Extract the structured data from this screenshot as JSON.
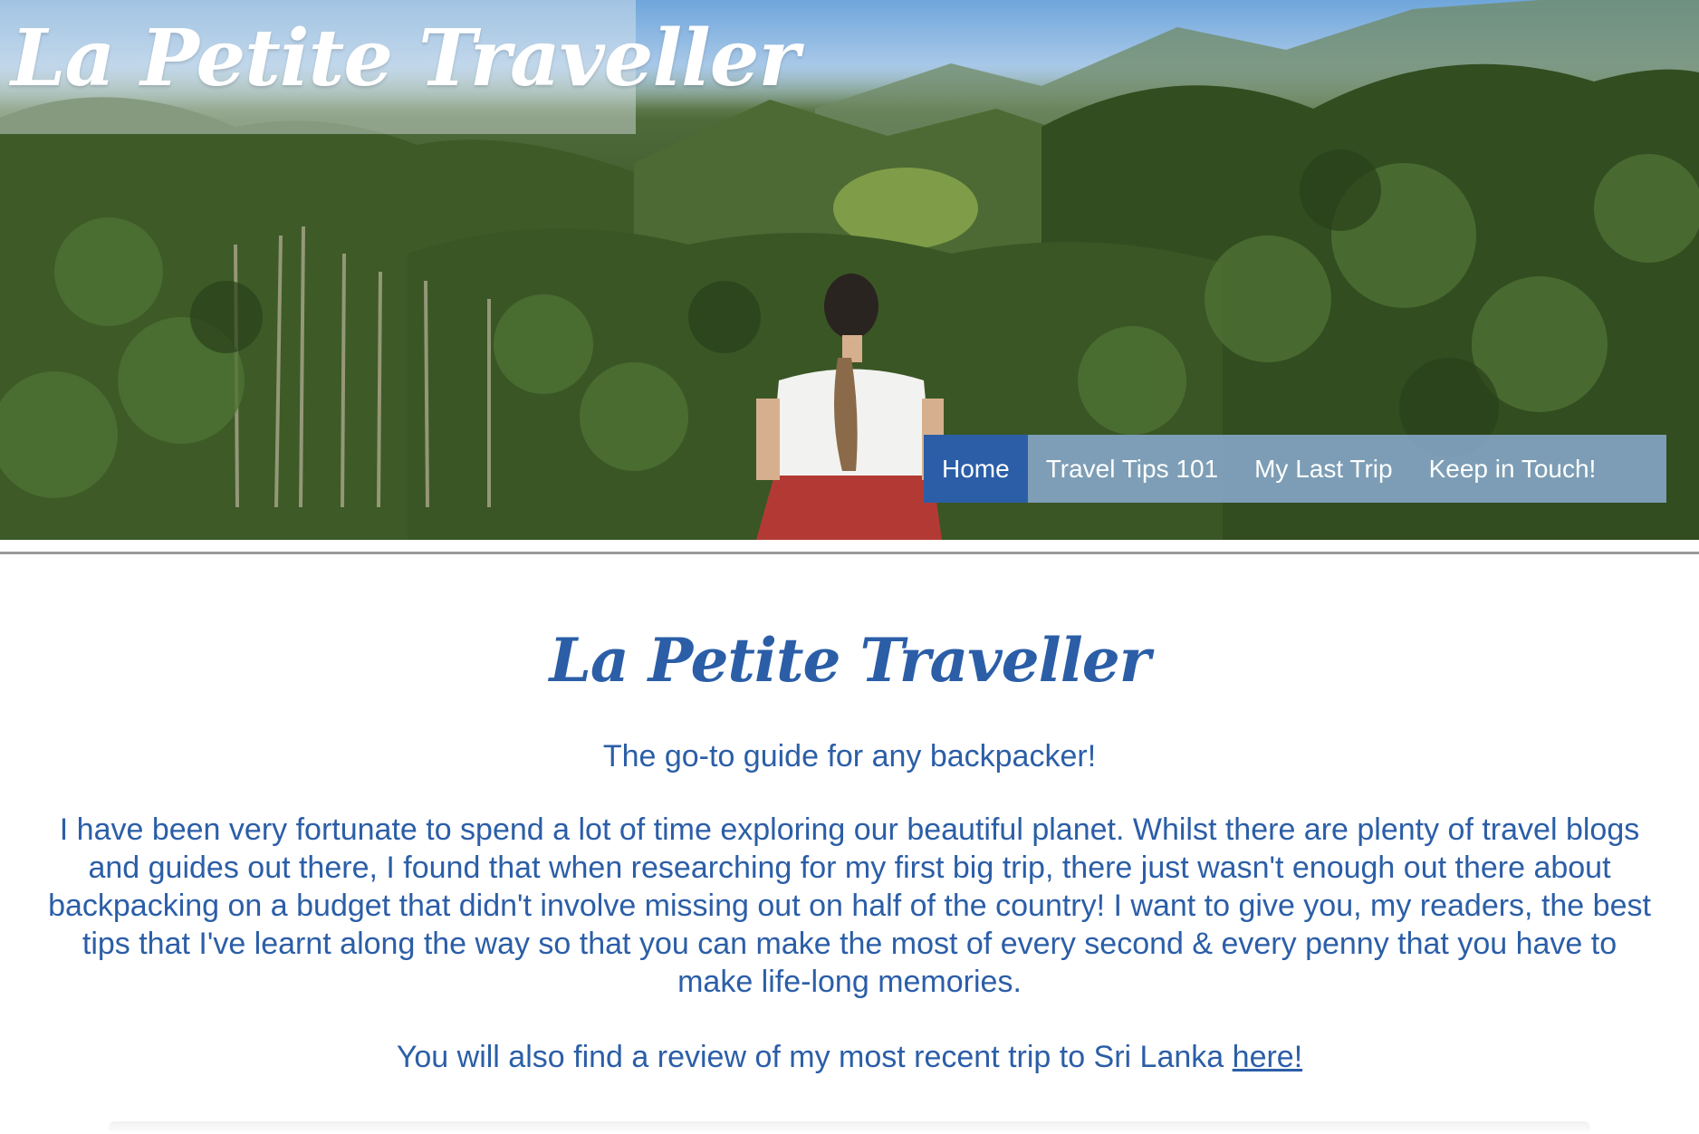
{
  "header": {
    "logo_text": "La Petite Traveller",
    "hero_image_alt": "hero-photo"
  },
  "nav": {
    "items": [
      {
        "label": "Home",
        "active": true
      },
      {
        "label": "Travel Tips 101",
        "active": false
      },
      {
        "label": "My Last Trip",
        "active": false
      },
      {
        "label": "Keep in Touch!",
        "active": false
      }
    ]
  },
  "main": {
    "title": "La Petite Traveller",
    "tagline": "The go-to guide for any backpacker!",
    "intro": "I have been very fortunate to spend a lot of time exploring our beautiful planet. Whilst there are plenty of travel blogs and guides out there, I found that when researching for my first big trip, there just wasn't enough out there about backpacking on a budget that didn't involve missing out on half of the country! I want to give you, my readers, the best tips that I've learnt along the way so that you can make the most of every second & every penny that you have to make life-long memories.",
    "recent_prefix": "You will also find a review of my most recent trip to Sri Lanka ",
    "recent_link": "here!"
  },
  "colors": {
    "accent": "#2b5ea7",
    "nav_bg": "#8cafd7",
    "divider": "#9a9a9a"
  }
}
